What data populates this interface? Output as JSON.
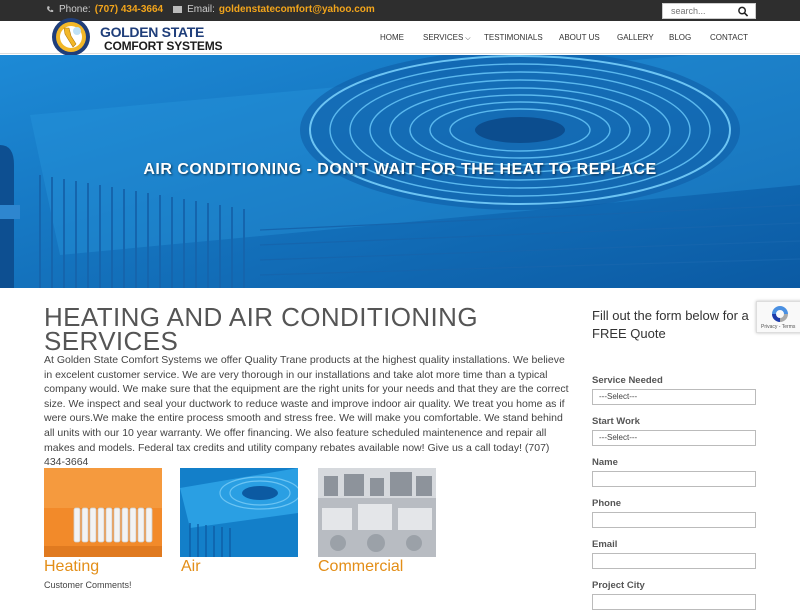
{
  "topbar": {
    "phone_label": "Phone:",
    "phone_value": "(707) 434-3664",
    "email_label": "Email:",
    "email_value": "goldenstatecomfort@yahoo.com",
    "search_placeholder": "search..."
  },
  "header": {
    "brand_line1": "GOLDEN STATE",
    "brand_line2": "COMFORT SYSTEMS",
    "nav": [
      "HOME",
      "SERVICES",
      "TESTIMONIALS",
      "ABOUT US",
      "GALLERY",
      "BLOG",
      "CONTACT"
    ]
  },
  "hero": {
    "title": "AIR CONDITIONING - DON'T WAIT FOR THE HEAT TO REPLACE"
  },
  "main": {
    "title": "HEATING AND AIR CONDITIONING SERVICES",
    "paragraph": "At Golden State Comfort Systems we offer Quality Trane products at the highest quality installations. We believe in excelent customer service. We are very thorough in our installations and take alot more time than a typical company would. We make sure that the equipment are the right units for your needs and that they are the correct size. We inspect and seal your ductwork to reduce waste and improve indoor air quality. We treat you home as if were ours.We make the entire process smooth and stress free. We will make you comfortable. We stand behind all units with our 10 year warranty. We offer financing. We also feature scheduled maintenence and repair all makes and models. Federal tax credits and utility company rebates available now! Give us a call today! (707) 434-3664",
    "services": [
      {
        "label": "Heating"
      },
      {
        "label": "Air"
      },
      {
        "label": "Commercial"
      }
    ],
    "comments_label": "Customer Comments!"
  },
  "form": {
    "intro": "Fill out the form below for a FREE Quote",
    "service_needed_label": "Service Needed",
    "service_needed_value": "---Select---",
    "start_work_label": "Start Work",
    "start_work_value": "---Select---",
    "name_label": "Name",
    "phone_label": "Phone",
    "email_label": "Email",
    "city_label": "Project City"
  },
  "recaptcha": {
    "text": "Privacy - Terms"
  },
  "colors": {
    "accent_orange": "#e38e17",
    "topbar_bg": "#2e2e2e",
    "brand_blue": "#1f3e7a",
    "hero_blue": "#1a7fcf"
  }
}
